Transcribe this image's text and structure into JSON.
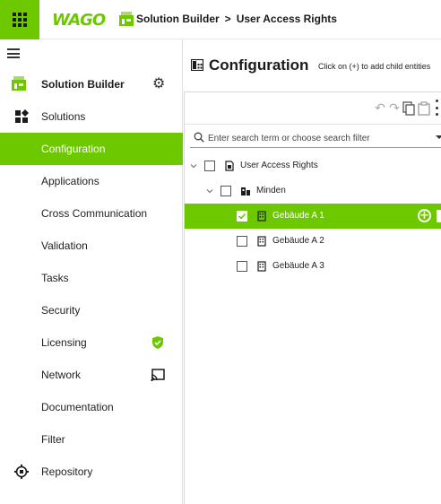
{
  "topbar": {
    "logo_text": "WAGO",
    "breadcrumb": [
      {
        "label": "Solution Builder"
      },
      {
        "label": "User Access Rights"
      }
    ],
    "separator": ">"
  },
  "sidebar": {
    "header": {
      "title": "Solution Builder",
      "settings_icon": "gear-icon"
    },
    "items": [
      {
        "label": "Solutions",
        "icon": "solutions-icon",
        "active": false
      },
      {
        "label": "Configuration",
        "icon": "",
        "active": true
      },
      {
        "label": "Applications",
        "icon": "",
        "active": false
      },
      {
        "label": "Cross Communication",
        "icon": "",
        "active": false
      },
      {
        "label": "Validation",
        "icon": "",
        "active": false
      },
      {
        "label": "Tasks",
        "icon": "",
        "active": false
      },
      {
        "label": "Security",
        "icon": "",
        "active": false
      },
      {
        "label": "Licensing",
        "icon": "",
        "badge": "shield-check-icon",
        "active": false
      },
      {
        "label": "Network",
        "icon": "",
        "badge": "cast-icon",
        "active": false
      },
      {
        "label": "Documentation",
        "icon": "",
        "active": false
      },
      {
        "label": "Filter",
        "icon": "",
        "active": false
      },
      {
        "label": "Repository",
        "icon": "repository-icon",
        "active": false
      }
    ]
  },
  "main": {
    "title": "Configuration",
    "hint": "Click on (+) to add child entities",
    "toolbar": {
      "buttons": [
        "undo-icon",
        "redo-icon",
        "copy-icon",
        "paste-icon",
        "more-icon"
      ]
    },
    "search": {
      "placeholder": "Enter search term or choose search filter",
      "value": ""
    },
    "tree": [
      {
        "label": "User Access Rights",
        "level": 0,
        "expanded": true,
        "checked": false,
        "selected": false,
        "icon": "document-icon"
      },
      {
        "label": "Minden",
        "level": 1,
        "expanded": true,
        "checked": false,
        "selected": false,
        "icon": "building-icon"
      },
      {
        "label": "Gebäude A 1",
        "level": 2,
        "checked": true,
        "selected": true,
        "icon": "device-icon"
      },
      {
        "label": "Gebäude A 2",
        "level": 2,
        "checked": false,
        "selected": false,
        "icon": "device-icon"
      },
      {
        "label": "Gebäude A 3",
        "level": 2,
        "checked": false,
        "selected": false,
        "icon": "device-icon"
      }
    ]
  },
  "colors": {
    "accent": "#6ec800",
    "text": "#222222",
    "border": "#d8d8d8"
  }
}
